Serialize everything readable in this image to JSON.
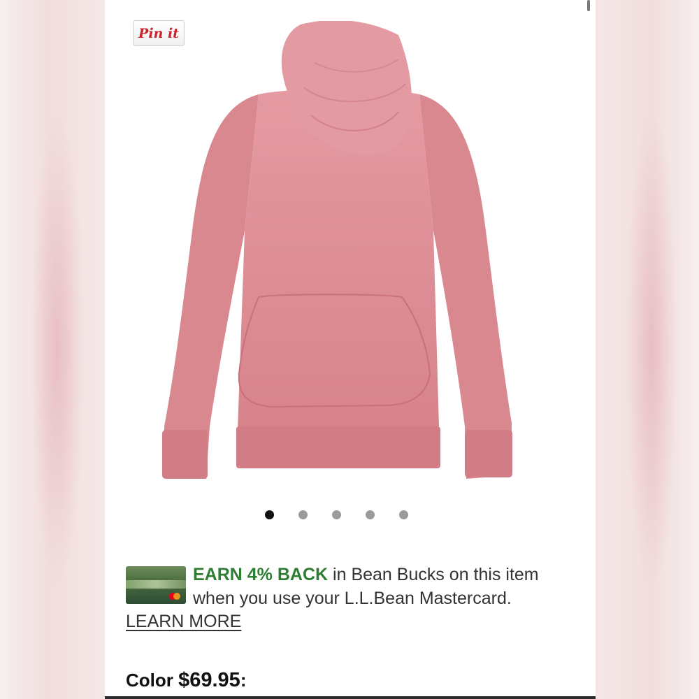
{
  "pin_button": {
    "label": "Pin it"
  },
  "product": {
    "image": "pink cowl-neck pullover sweatshirt",
    "color_accent": "#d77c86"
  },
  "carousel": {
    "total": 5,
    "active_index": 0
  },
  "promo": {
    "highlight": "EARN 4% BACK",
    "text": " in Bean Bucks on this item when you use your L.L.Bean Mastercard. ",
    "link": "LEARN MORE",
    "card_icon": "credit-card-icon",
    "highlight_color": "#2f7d33"
  },
  "price_line": {
    "prefix": "Color ",
    "price": "$69.95",
    "suffix": ":"
  }
}
